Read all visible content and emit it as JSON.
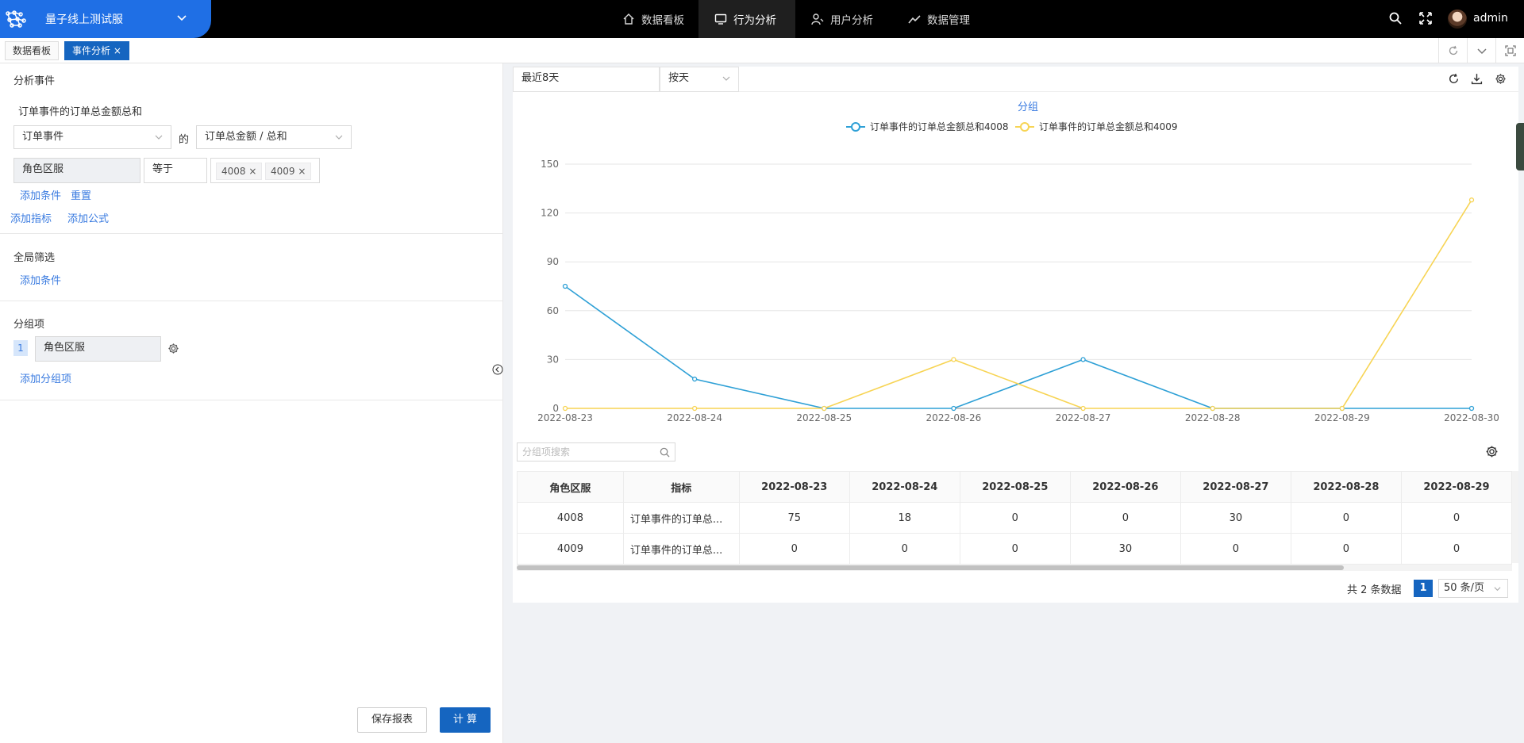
{
  "header": {
    "app_title": "量子线上测试服",
    "nav": [
      "数据看板",
      "行为分析",
      "用户分析",
      "数据管理"
    ],
    "active_nav": "行为分析",
    "username": "admin"
  },
  "tabs": [
    {
      "label": "数据看板"
    },
    {
      "label": "事件分析 ×"
    }
  ],
  "left": {
    "section_events": "分析事件",
    "metric_title": "订单事件的订单总金额总和",
    "event_select": "订单事件",
    "of_label": "的",
    "property_select": "订单总金额 / 总和",
    "filter_field": "角色区服",
    "filter_op": "等于",
    "filter_values": [
      "4008 ×",
      "4009 ×"
    ],
    "add_condition": "添加条件",
    "reset": "重置",
    "add_metric": "添加指标",
    "add_formula": "添加公式",
    "section_global": "全局筛选",
    "global_add_condition": "添加条件",
    "section_group": "分组项",
    "group_index": "1",
    "group_field": "角色区服",
    "add_group": "添加分组项",
    "save_button": "保存报表",
    "calc_button": "计 算"
  },
  "toolbar": {
    "date_range": "最近8天",
    "granularity": "按天"
  },
  "chart_data": {
    "type": "line",
    "title": "分组",
    "categories": [
      "2022-08-23",
      "2022-08-24",
      "2022-08-25",
      "2022-08-26",
      "2022-08-27",
      "2022-08-28",
      "2022-08-29",
      "2022-08-30"
    ],
    "yticks": [
      "0",
      "30",
      "60",
      "90",
      "120",
      "150"
    ],
    "ylim": [
      0,
      150
    ],
    "legend_position": "top-center",
    "series": [
      {
        "name": "订单事件的订单总金额总和4008",
        "color": "#2ea0d6",
        "values": [
          75,
          18,
          0,
          0,
          30,
          0,
          0,
          0
        ]
      },
      {
        "name": "订单事件的订单总金额总和4009",
        "color": "#f7d454",
        "values": [
          0,
          0,
          0,
          30,
          0,
          0,
          0,
          128
        ]
      }
    ]
  },
  "table": {
    "search_placeholder": "分组项搜索",
    "columns": [
      "角色区服",
      "指标",
      "2022-08-23",
      "2022-08-24",
      "2022-08-25",
      "2022-08-26",
      "2022-08-27",
      "2022-08-28",
      "2022-08-29"
    ],
    "rows": [
      [
        "4008",
        "订单事件的订单总...",
        "75",
        "18",
        "0",
        "0",
        "30",
        "0",
        "0"
      ],
      [
        "4009",
        "订单事件的订单总...",
        "0",
        "0",
        "0",
        "30",
        "0",
        "0",
        "0"
      ]
    ]
  },
  "pagination": {
    "total": "共 2 条数据",
    "page": "1",
    "page_size": "50 条/页"
  }
}
